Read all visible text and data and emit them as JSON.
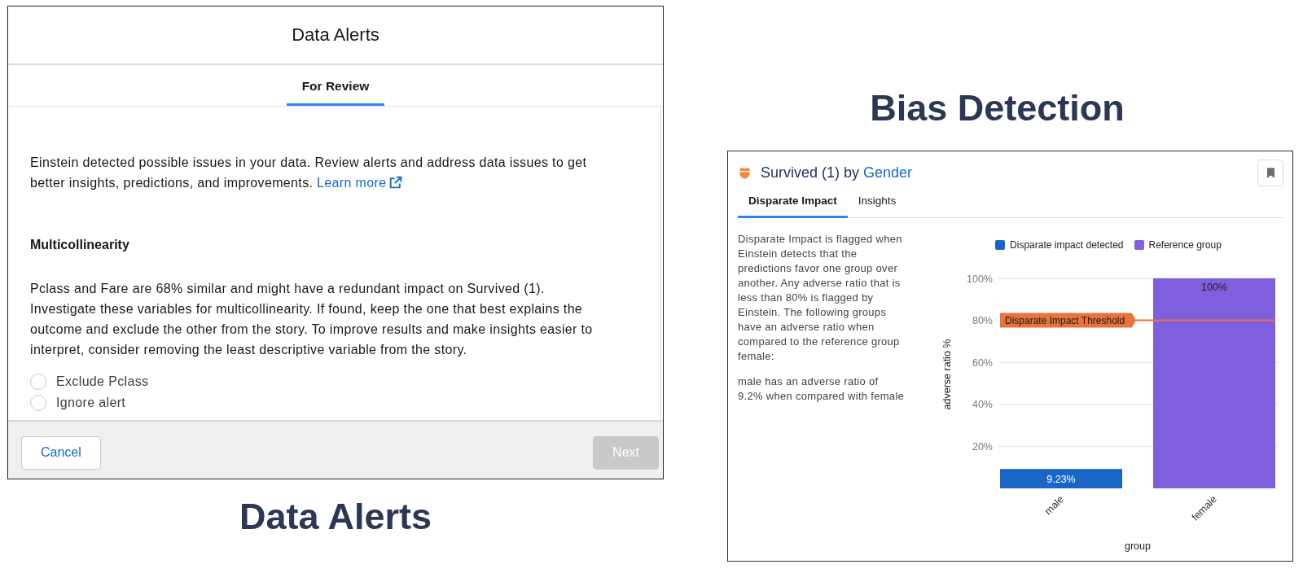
{
  "data_alerts_panel": {
    "dialog": {
      "title": "Data Alerts",
      "tabs": [
        {
          "label": "For Review",
          "selected": true
        }
      ],
      "intro": "Einstein detected possible issues in your data. Review alerts and address data issues to get better insights, predictions, and improvements.",
      "learn_more": "Learn more",
      "alert": {
        "heading": "Multicollinearity",
        "description": "Pclass and Fare are 68% similar and might have a redundant impact on Survived (1). Investigate these variables for multicollinearity. If found, keep the one that best explains the outcome and exclude the other from the story. To improve results and make insights easier to interpret, consider removing the least descriptive variable from the story.",
        "options": [
          {
            "label": "Exclude Pclass",
            "selected": false
          },
          {
            "label": "Ignore alert",
            "selected": false
          }
        ]
      },
      "buttons": [
        {
          "label": "Cancel",
          "kind": "neutral",
          "disabled": false
        },
        {
          "label": "Next",
          "kind": "brand",
          "disabled": true
        }
      ]
    },
    "caption": "Data Alerts"
  },
  "bias_detection_panel": {
    "caption": "Bias Detection",
    "card": {
      "title": "Survived (1) by",
      "title_link": "Gender",
      "tabs": [
        {
          "label": "Disparate Impact",
          "selected": true
        },
        {
          "label": "Insights",
          "selected": false
        }
      ],
      "description": "Disparate Impact is flagged when Einstein detects that the predictions favor one group over another. Any adverse ratio that is less than 80% is flagged by Einstein. The following groups have an adverse ratio when compared to the reference group female:",
      "finding": "male has an adverse ratio of 9.2% when compared with female",
      "chart_data": {
        "type": "bar",
        "xlabel": "group",
        "ylabel": "adverse ratio %",
        "categories": [
          "male",
          "female"
        ],
        "series": [
          {
            "name": "Disparate impact detected",
            "color": "#1a66c8",
            "values": [
              9.23,
              null
            ]
          },
          {
            "name": "Reference group",
            "color": "#7f5fde",
            "values": [
              null,
              100
            ]
          }
        ],
        "ylim": [
          0,
          100
        ],
        "yticks": [
          {
            "value": 20,
            "label": "20%"
          },
          {
            "value": 40,
            "label": "40%"
          },
          {
            "value": 60,
            "label": "60%"
          },
          {
            "value": 80,
            "label": "80%"
          },
          {
            "value": 100,
            "label": "100%"
          }
        ],
        "stacked": true,
        "grid": true,
        "legend": "top",
        "value_labels": [
          "9.23%",
          "100%"
        ],
        "ref_lines": [
          {
            "axis": "y",
            "value": 80,
            "label": "Disparate Impact Threshold",
            "color": "#e8743b"
          }
        ]
      }
    }
  }
}
